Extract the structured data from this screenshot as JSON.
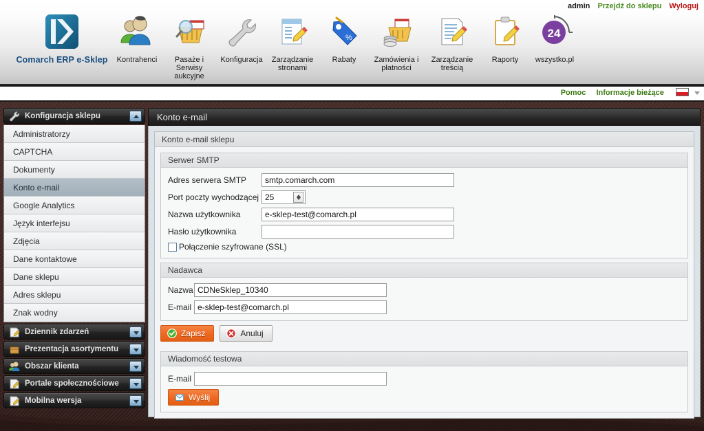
{
  "header": {
    "user": {
      "name": "admin",
      "goto_shop": "Przejdź do sklepu",
      "logout": "Wyloguj"
    },
    "subbar": {
      "help": "Pomoc",
      "news": "Informacje bieżące",
      "flag": "pl-flag-icon"
    },
    "nav": [
      {
        "label": "Comarch ERP e-Sklep",
        "icon": "comarch-logo-icon",
        "brand": true
      },
      {
        "label": "Kontrahenci",
        "icon": "users-icon"
      },
      {
        "label": "Pasaże i Serwisy aukcyjne",
        "icon": "basket-search-icon"
      },
      {
        "label": "Konfiguracja",
        "icon": "wrench-icon"
      },
      {
        "label": "Zarządzanie stronami",
        "icon": "page-edit-icon"
      },
      {
        "label": "Rabaty",
        "icon": "price-tag-icon"
      },
      {
        "label": "Zamówienia i płatności",
        "icon": "basket-coins-icon"
      },
      {
        "label": "Zarządzanie treścią",
        "icon": "document-edit-icon"
      },
      {
        "label": "Raporty",
        "icon": "clipboard-pencil-icon"
      },
      {
        "label": "wszystko.pl",
        "icon": "24-circle-icon"
      }
    ]
  },
  "sidebar": {
    "groups": [
      {
        "title": "Konfiguracja sklepu",
        "icon": "wrench-icon",
        "expanded": true,
        "items": [
          {
            "label": "Administratorzy",
            "active": false
          },
          {
            "label": "CAPTCHA",
            "active": false
          },
          {
            "label": "Dokumenty",
            "active": false
          },
          {
            "label": "Konto e-mail",
            "active": true
          },
          {
            "label": "Google Analytics",
            "active": false
          },
          {
            "label": "Język interfejsu",
            "active": false
          },
          {
            "label": "Zdjęcia",
            "active": false
          },
          {
            "label": "Dane kontaktowe",
            "active": false
          },
          {
            "label": "Dane sklepu",
            "active": false
          },
          {
            "label": "Adres sklepu",
            "active": false
          },
          {
            "label": "Znak wodny",
            "active": false
          }
        ]
      },
      {
        "title": "Dziennik zdarzeń",
        "icon": "notebook-icon",
        "expanded": false,
        "items": []
      },
      {
        "title": "Prezentacja asortymentu",
        "icon": "box-icon",
        "expanded": false,
        "items": []
      },
      {
        "title": "Obszar klienta",
        "icon": "users-icon",
        "expanded": false,
        "items": []
      },
      {
        "title": "Portale społecznościowe",
        "icon": "note-pencil-icon",
        "expanded": false,
        "items": []
      },
      {
        "title": "Mobilna wersja",
        "icon": "note-pencil-icon",
        "expanded": false,
        "items": []
      }
    ]
  },
  "content": {
    "title": "Konto e-mail",
    "panel_title": "Konto e-mail sklepu",
    "smtp": {
      "legend": "Serwer SMTP",
      "fields": [
        {
          "label": "Adres serwera SMTP",
          "value": "smtp.comarch.com",
          "placeholder": "",
          "type": "text"
        },
        {
          "label": "Port poczty wychodzącej",
          "value": "25",
          "placeholder": "",
          "type": "spinner"
        },
        {
          "label": "Nazwa użytkownika",
          "value": "e-sklep-test@comarch.pl",
          "placeholder": "",
          "type": "text"
        },
        {
          "label": "Hasło użytkownika",
          "value": "",
          "placeholder": "",
          "type": "password"
        }
      ],
      "ssl_label": "Połączenie szyfrowane (SSL)",
      "ssl_checked": false
    },
    "sender": {
      "legend": "Nadawca",
      "name_label": "Nazwa",
      "name_value": "CDNeSklep_10340",
      "email_label": "E-mail",
      "email_value": "e-sklep-test@comarch.pl"
    },
    "actions": {
      "save": "Zapisz",
      "cancel": "Anuluj"
    },
    "test": {
      "legend": "Wiadomość testowa",
      "email_label": "E-mail",
      "email_value": "",
      "send": "Wyślij"
    }
  },
  "colors": {
    "accent_orange": "#ee6a22",
    "link_green": "#4b8b22",
    "logout_red": "#b61010",
    "brand_blue": "#1a4f80",
    "active_row": "#a9b6c0",
    "desktop": "#3b2420"
  }
}
